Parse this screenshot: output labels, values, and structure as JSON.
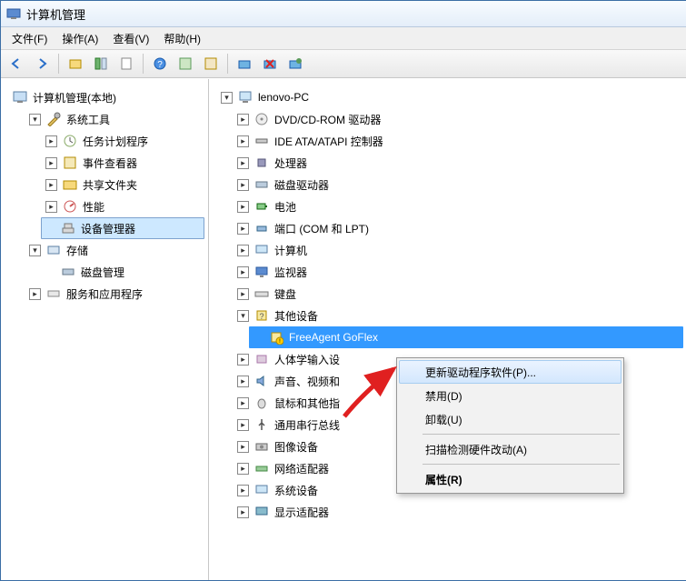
{
  "window": {
    "title": "计算机管理"
  },
  "menu": {
    "file": "文件(F)",
    "action": "操作(A)",
    "view": "查看(V)",
    "help": "帮助(H)"
  },
  "left_tree": {
    "root": "计算机管理(本地)",
    "system_tools": {
      "label": "系统工具",
      "children": {
        "task": "任务计划程序",
        "event": "事件查看器",
        "shared": "共享文件夹",
        "perf": "性能",
        "devmgr": "设备管理器"
      }
    },
    "storage": {
      "label": "存储",
      "children": {
        "disk": "磁盘管理"
      }
    },
    "services": "服务和应用程序"
  },
  "right_tree": {
    "root": "lenovo-PC",
    "items": {
      "dvd": "DVD/CD-ROM 驱动器",
      "ide": "IDE ATA/ATAPI 控制器",
      "cpu": "处理器",
      "diskdrive": "磁盘驱动器",
      "battery": "电池",
      "ports": "端口 (COM 和 LPT)",
      "computer": "计算机",
      "monitor": "监视器",
      "keyboard": "键盘",
      "other": {
        "label": "其他设备",
        "child": "FreeAgent GoFlex"
      },
      "hid": "人体学输入设",
      "sound": "声音、视频和",
      "mouse": "鼠标和其他指",
      "usb": "通用串行总线",
      "imaging": "图像设备",
      "net": "网络适配器",
      "sysdev": "系统设备",
      "display": "显示适配器"
    }
  },
  "context_menu": {
    "update": "更新驱动程序软件(P)...",
    "disable": "禁用(D)",
    "uninstall": "卸载(U)",
    "scan": "扫描检测硬件改动(A)",
    "properties": "属性(R)"
  }
}
